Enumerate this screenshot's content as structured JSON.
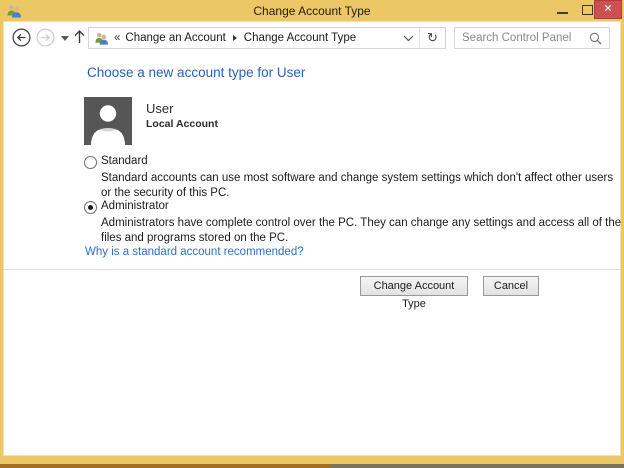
{
  "titlebar": {
    "title": "Change Account Type",
    "close_glyph": "✕"
  },
  "toolbar": {
    "breadcrumb": {
      "overflow_glyph": "«",
      "items": [
        "Change an Account",
        "Change Account Type"
      ]
    },
    "refresh_glyph": "↻",
    "search": {
      "placeholder": "Search Control Panel"
    }
  },
  "content": {
    "heading": "Choose a new account type for User",
    "user_card": {
      "name": "User",
      "type": "Local Account"
    },
    "options": [
      {
        "label": "Standard",
        "selected": false,
        "description": "Standard accounts can use most software and change system settings which don't affect other users or the security of this PC."
      },
      {
        "label": "Administrator",
        "selected": true,
        "description": "Administrators have complete control over the PC. They can change any settings and access all of the files and programs stored on the PC."
      }
    ],
    "help_link": "Why is a standard account recommended?",
    "buttons": [
      {
        "label": "Change Account Type"
      },
      {
        "label": "Cancel"
      }
    ]
  },
  "colors": {
    "titlebar": "#ecc766",
    "close_button": "#cb5050",
    "heading": "#2760bd",
    "link": "#2d6fc4",
    "avatar_bg": "#565656"
  }
}
